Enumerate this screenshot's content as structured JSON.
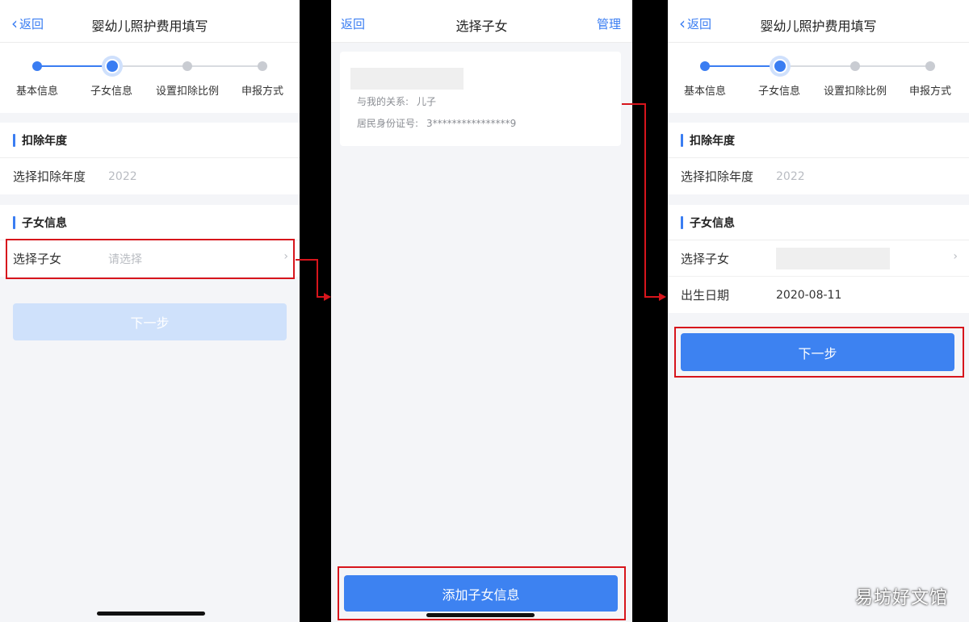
{
  "colors": {
    "accent": "#3a7df2",
    "highlight": "#d7151c",
    "disabled": "#cfe1fb"
  },
  "icons": {
    "back": "chevron-left-icon",
    "row": "chevron-right-icon"
  },
  "screen1": {
    "back_label": "返回",
    "title": "婴幼儿照护费用填写",
    "steps": [
      "基本信息",
      "子女信息",
      "设置扣除比例",
      "申报方式"
    ],
    "deduct_section": "扣除年度",
    "year_label": "选择扣除年度",
    "year_value": "2022",
    "child_section": "子女信息",
    "child_label": "选择子女",
    "child_placeholder": "请选择",
    "next_label": "下一步"
  },
  "screen2": {
    "back_label": "返回",
    "title": "选择子女",
    "manage_label": "管理",
    "relation_label": "与我的关系:",
    "relation_value": "儿子",
    "id_label": "居民身份证号:",
    "id_value": "3****************9",
    "add_label": "添加子女信息"
  },
  "screen3": {
    "back_label": "返回",
    "title": "婴幼儿照护费用填写",
    "steps": [
      "基本信息",
      "子女信息",
      "设置扣除比例",
      "申报方式"
    ],
    "deduct_section": "扣除年度",
    "year_label": "选择扣除年度",
    "year_value": "2022",
    "child_section": "子女信息",
    "child_label": "选择子女",
    "birth_label": "出生日期",
    "birth_value": "2020-08-11",
    "next_label": "下一步"
  },
  "watermark": "易坊好文馆"
}
